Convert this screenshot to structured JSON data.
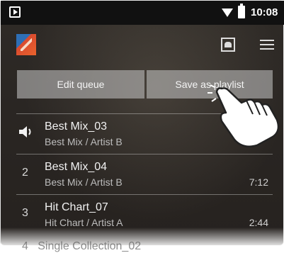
{
  "status_bar": {
    "time": "10:08",
    "icons": [
      "play-store-icon",
      "wifi-icon",
      "battery-icon"
    ]
  },
  "app_bar": {
    "icons": [
      "app-logo-icon",
      "cast-icon",
      "menu-icon"
    ]
  },
  "buttons": {
    "edit_queue": "Edit queue",
    "save_as_playlist": "Save as playlist"
  },
  "queue": [
    {
      "index": "",
      "title": "Best Mix_03",
      "subtitle": "Best Mix / Artist B",
      "duration": "",
      "playing": true
    },
    {
      "index": "2",
      "title": "Best Mix_04",
      "subtitle": "Best Mix / Artist B",
      "duration": "7:12"
    },
    {
      "index": "3",
      "title": "Hit Chart_07",
      "subtitle": "Hit Chart / Artist A",
      "duration": "2:44"
    }
  ],
  "peek_row": {
    "index": "4",
    "title": "Single Collection_02"
  },
  "colors": {
    "background": "#2a2623",
    "button": "#c8c8c8",
    "text": "#f2f2f2",
    "subtext": "#bdbdbd"
  }
}
